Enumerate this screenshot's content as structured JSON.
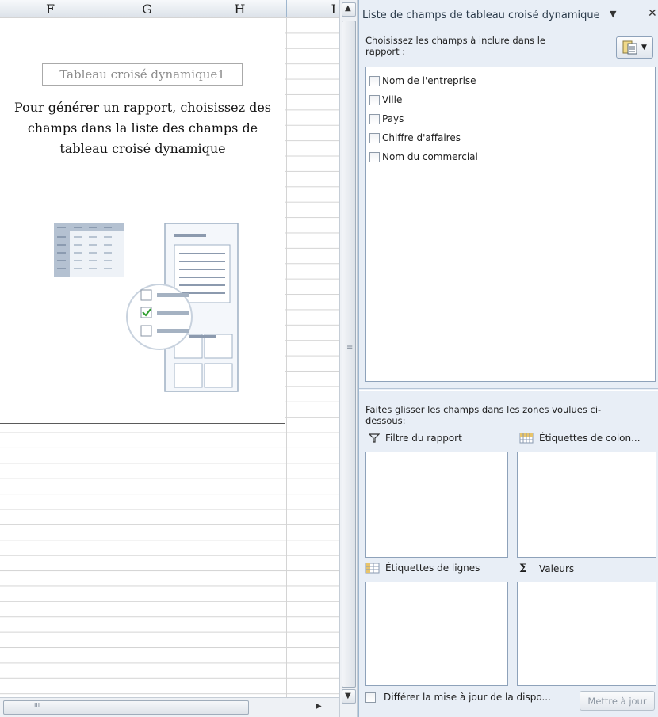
{
  "sheet": {
    "columns": [
      "F",
      "G",
      "H",
      "I"
    ],
    "pivot_name": "Tableau croisé dynamique1",
    "pivot_hint": "Pour générer un rapport, choisissez des champs dans la liste des champs de tableau croisé dynamique",
    "h_scroll_grip": "III"
  },
  "pane": {
    "title": "Liste de champs de tableau croisé dynamique",
    "menu_glyph": "▼",
    "close_glyph": "✕",
    "choose_label": "Choisissez les champs à inclure dans le rapport :",
    "fields": [
      {
        "label": "Nom de l'entreprise",
        "checked": false
      },
      {
        "label": "Ville",
        "checked": false
      },
      {
        "label": "Pays",
        "checked": false
      },
      {
        "label": "Chiffre d'affaires",
        "checked": false
      },
      {
        "label": "Nom du commercial",
        "checked": false
      }
    ],
    "drag_label": "Faites glisser les champs dans les zones voulues ci-dessous:",
    "zones": {
      "filter": "Filtre du rapport",
      "columns": "Étiquettes de colon...",
      "rows": "Étiquettes de lignes",
      "values": "Valeurs",
      "sigma": "Σ"
    },
    "defer_label": "Différer la mise à jour de la dispo...",
    "update_button": "Mettre à jour"
  },
  "colors": {
    "pane_bg": "#e8eef6",
    "border": "#8ea2ba",
    "check_green": "#2e9e2e"
  }
}
